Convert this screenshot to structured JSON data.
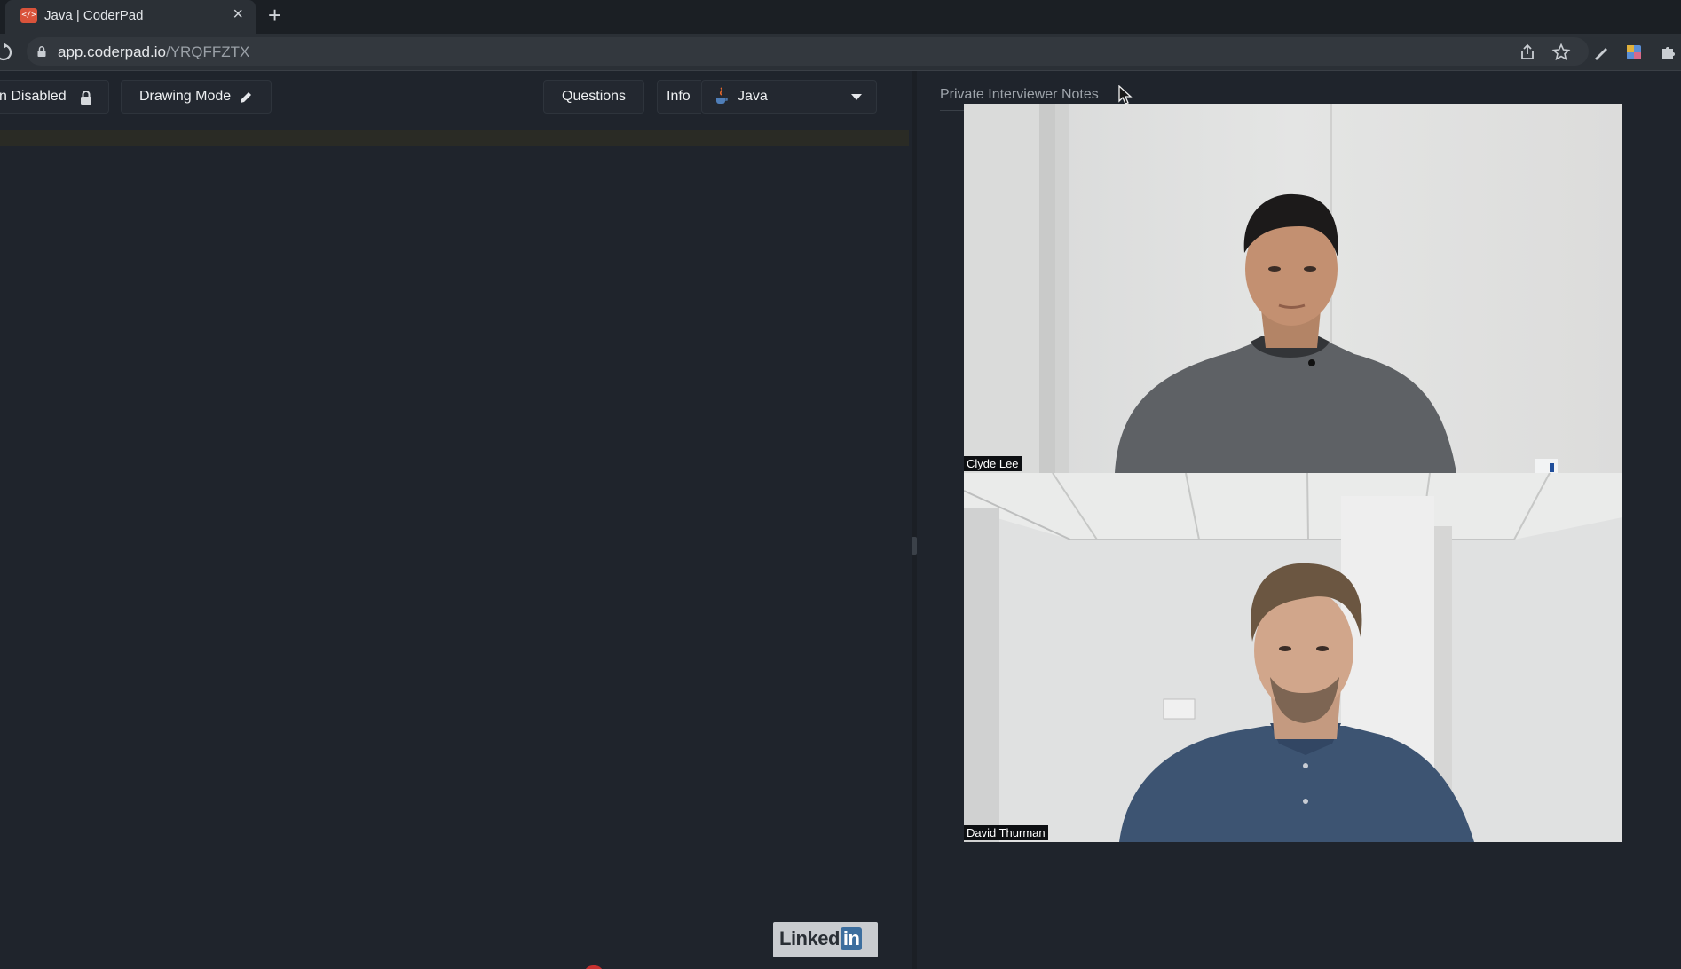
{
  "browser": {
    "tab_title": "Java | CoderPad",
    "tab_favicon": "</>",
    "tab_close": "×",
    "new_tab": "+",
    "url_domain": "app.coderpad.io",
    "url_path": "/YRQFFZTX",
    "toolbar_icons": [
      "share-icon",
      "star-icon",
      "pen-icon",
      "profile-icon",
      "extensions-icon"
    ]
  },
  "toolbar": {
    "playback_label": "n Disabled",
    "drawing_mode_label": "Drawing Mode",
    "questions_label": "Questions",
    "info_label": "Info",
    "language_selected": "Java"
  },
  "right_pane": {
    "notes_tab_label": "Private Interviewer Notes"
  },
  "videos": [
    {
      "name": "Clyde Lee"
    },
    {
      "name": "David Thurman"
    }
  ],
  "watermark": {
    "brand_text": "Linked",
    "brand_in": "in"
  },
  "colors": {
    "background": "#1f242c",
    "tab_favicon": "#d9533b",
    "linkedin_blue": "#3c6e9e"
  }
}
